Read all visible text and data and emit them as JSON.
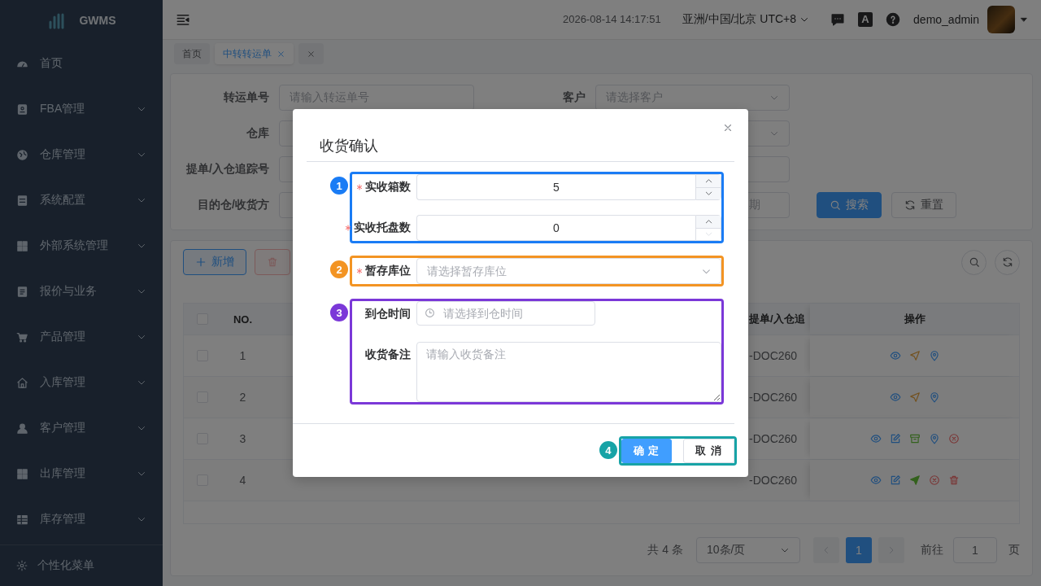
{
  "sidebar": {
    "logo_text": "GWMS",
    "items": [
      {
        "label": "首页",
        "expandable": false
      },
      {
        "label": "FBA管理",
        "expandable": true
      },
      {
        "label": "仓库管理",
        "expandable": true
      },
      {
        "label": "系统配置",
        "expandable": true
      },
      {
        "label": "外部系统管理",
        "expandable": true
      },
      {
        "label": "报价与业务",
        "expandable": true
      },
      {
        "label": "产品管理",
        "expandable": true
      },
      {
        "label": "入库管理",
        "expandable": true
      },
      {
        "label": "客户管理",
        "expandable": true
      },
      {
        "label": "出库管理",
        "expandable": true
      },
      {
        "label": "库存管理",
        "expandable": true
      }
    ],
    "footer_label": "个性化菜单"
  },
  "header": {
    "datetime": "2026-08-14 14:17:51",
    "timezone": "亚洲/中国/北京 UTC+8",
    "language_glyph": "A",
    "username": "demo_admin"
  },
  "tabs": [
    {
      "label": "首页",
      "selected": false,
      "closable": false
    },
    {
      "label": "中转转运单",
      "selected": true,
      "closable": true
    },
    {
      "selected": false,
      "closable": true
    }
  ],
  "filters": {
    "left": [
      {
        "label": "转运单号",
        "placeholder": "请输入转运单号"
      },
      {
        "label": "仓库"
      },
      {
        "label": "提单/入仓追踪号"
      },
      {
        "label": "目的仓/收货方"
      }
    ],
    "right": [
      {
        "kind": "select",
        "label": "客户",
        "placeholder": "请选择客户"
      },
      {
        "kind": "select"
      },
      {
        "kind": "input"
      },
      {
        "kind": "date",
        "placeholder": "期"
      }
    ],
    "search_button": "搜索",
    "reset_button": "重置"
  },
  "toolbar": [
    {
      "kind": "add",
      "label": "新增",
      "disabled": false
    },
    {
      "kind": "delete",
      "disabled": true
    }
  ],
  "table": {
    "no_header": "NO.",
    "tracking_header": "提单/入仓追",
    "actions_header": "操作",
    "header_checked": false,
    "rows": [
      {
        "checked": false,
        "no": "1",
        "tracking": "-DOC260",
        "actions": [
          {
            "kind": "view"
          },
          {
            "kind": "dispatch"
          },
          {
            "kind": "locate"
          }
        ]
      },
      {
        "checked": false,
        "no": "2",
        "tracking": "-DOC260",
        "actions": [
          {
            "kind": "view"
          },
          {
            "kind": "dispatch"
          },
          {
            "kind": "locate"
          }
        ]
      },
      {
        "checked": false,
        "no": "3",
        "tracking": "-DOC260",
        "actions": [
          {
            "kind": "view"
          },
          {
            "kind": "edit"
          },
          {
            "kind": "archive"
          },
          {
            "kind": "locate"
          },
          {
            "kind": "cancel"
          }
        ]
      },
      {
        "checked": false,
        "no": "4",
        "tracking": "-DOC260",
        "actions": [
          {
            "kind": "view"
          },
          {
            "kind": "edit"
          },
          {
            "kind": "ship"
          },
          {
            "kind": "cancel"
          },
          {
            "kind": "delete"
          }
        ]
      }
    ]
  },
  "pagination": {
    "total": "共 4 条",
    "page_size": "10条/页",
    "pages": [
      {
        "label": "1",
        "selected": true
      }
    ],
    "goto_label": "前往",
    "goto_value": "1",
    "page_unit": "页"
  },
  "modal": {
    "title": "收货确认",
    "groups": [
      {
        "number": "1",
        "color": "#1a7cf5",
        "fields": [
          {
            "kind": "number",
            "label": "实收箱数",
            "required": true,
            "value": "5",
            "decrement_disabled": false
          },
          {
            "kind": "number",
            "label": "实收托盘数",
            "required": true,
            "value": "0",
            "decrement_disabled": true
          }
        ]
      },
      {
        "number": "2",
        "color": "#f39423",
        "fields": [
          {
            "kind": "select",
            "label": "暂存库位",
            "required": true,
            "placeholder": "请选择暂存库位"
          }
        ]
      },
      {
        "number": "3",
        "color": "#7b38d8",
        "fields": [
          {
            "kind": "datetime",
            "label": "到仓时间",
            "required": false,
            "placeholder": "请选择到仓时间"
          },
          {
            "kind": "textarea",
            "label": "收货备注",
            "required": false,
            "placeholder": "请输入收货备注"
          }
        ]
      }
    ],
    "footer": {
      "number": "4",
      "color": "#17a3a6",
      "buttons": [
        {
          "kind": "primary",
          "label": "确 定"
        },
        {
          "kind": "default",
          "label": "取 消"
        }
      ]
    }
  }
}
